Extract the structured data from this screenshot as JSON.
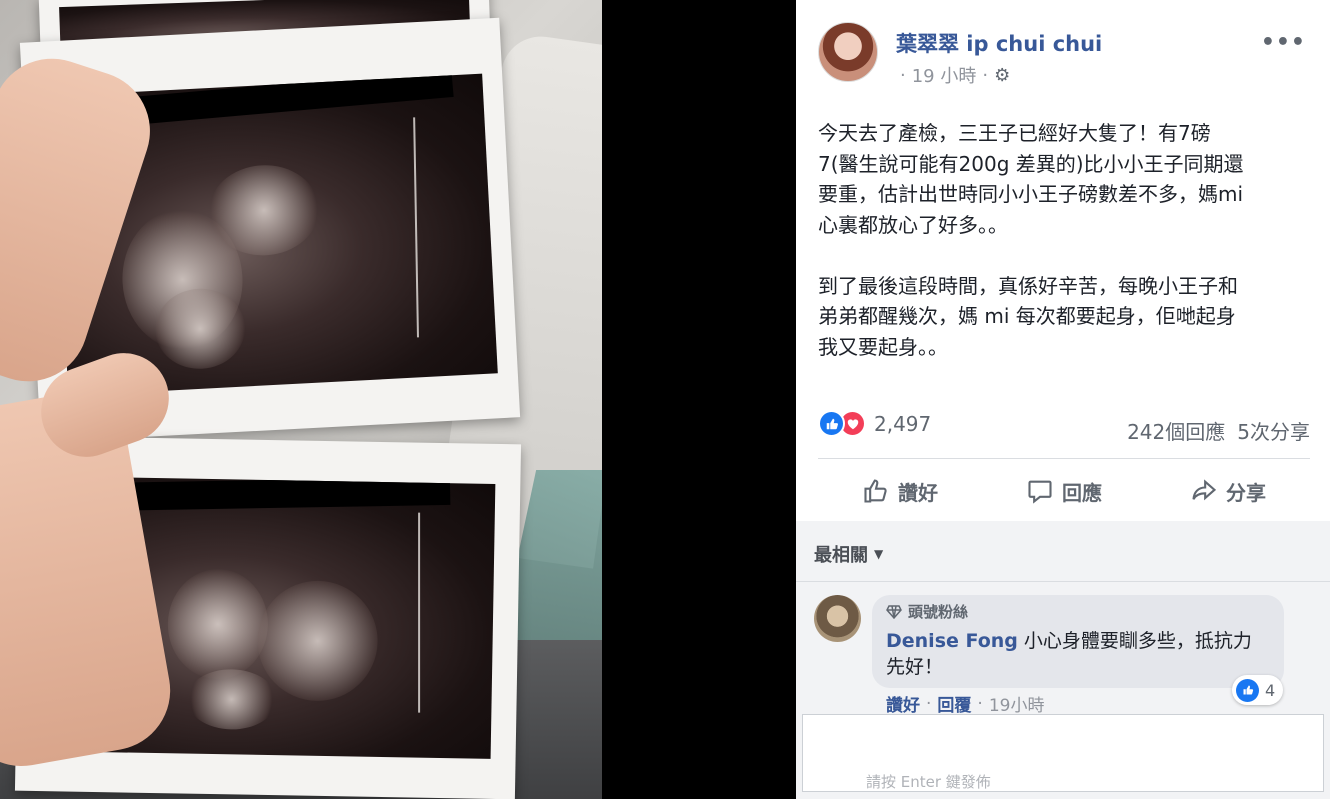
{
  "photo": {
    "alt_subject": "ultrasound-scans-in-hand"
  },
  "post": {
    "author": "葉翠翠 ip chui chui",
    "time": "19 小時",
    "separator": "·",
    "paragraph1": "今天去了產檢，三王子已經好大隻了！有7磅\n7(醫生說可能有200g 差異的)比小小王子同期還\n要重，估計出世時同小小王子磅數差不多，媽mi\n心裏都放心了好多。。",
    "paragraph2": "到了最後這段時間，真係好辛苦，每晚小王子和\n弟弟都醒幾次，媽 mi 每次都要起身，佢哋起身\n我又要起身。。",
    "reaction_count": "2,497",
    "comments_count": "242個回應",
    "shares_count": "5次分享"
  },
  "actions": {
    "like": "讚好",
    "comment": "回應",
    "share": "分享"
  },
  "comments": {
    "sort_label": "最相關",
    "top": {
      "badge": "頭號粉絲",
      "name": "Denise Fong",
      "text": "小心身體要瞓多些，抵抗力先好！",
      "like_count": "4",
      "like_action": "讚好",
      "reply_action": "回覆",
      "time": "19小時",
      "sep": "·"
    },
    "peek_text": "請按 Enter 鍵發佈"
  },
  "colors": {
    "link": "#385898",
    "like_blue": "#1877f2",
    "love_red": "#f33e58",
    "muted": "#606770"
  },
  "icons": [
    "gear-icon",
    "more-icon",
    "like-icon",
    "love-icon",
    "thumbs-up-icon",
    "comment-icon",
    "share-icon",
    "diamond-icon",
    "caret-down-icon"
  ]
}
